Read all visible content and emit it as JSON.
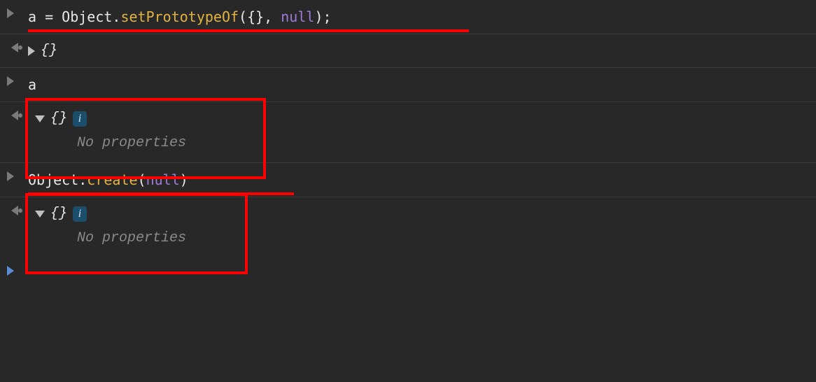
{
  "rows": [
    {
      "type": "input",
      "tokens": {
        "a": "a",
        "eq": " = ",
        "cls": "Object",
        "dot": ".",
        "method": "setPrototypeOf",
        "open": "({}, ",
        "kw": "null",
        "close": ");"
      }
    },
    {
      "type": "output",
      "braces": "{}"
    },
    {
      "type": "input_simple",
      "text": "a"
    },
    {
      "type": "output_expanded",
      "braces": "{}",
      "info": "i",
      "no_props": "No properties"
    },
    {
      "type": "input2",
      "tokens": {
        "cls": "Object",
        "dot": ".",
        "method": "create",
        "open": "(",
        "kw": "null",
        "close": ")"
      }
    },
    {
      "type": "output_expanded",
      "braces": "{}",
      "info": "i",
      "no_props": "No properties"
    }
  ]
}
